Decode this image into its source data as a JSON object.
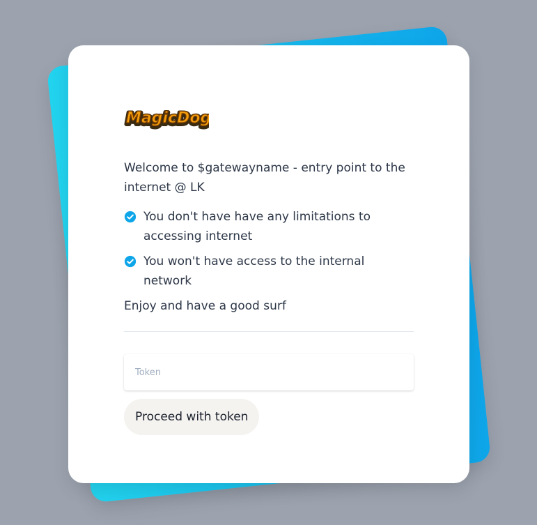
{
  "brand": {
    "logo_text": "MagicDog"
  },
  "content": {
    "welcome": "Welcome to $gatewayname - entry point to the internet @ LK",
    "features": [
      "You don't have have any limitations to accessing internet",
      "You won't have access to the internal network"
    ],
    "closing": "Enjoy and have a good surf"
  },
  "form": {
    "token_placeholder": "Token",
    "token_value": "",
    "proceed_label": "Proceed with token"
  },
  "colors": {
    "page_background": "#9ca3af",
    "accent_gradient_start": "#22d3ee",
    "accent_gradient_end": "#0ea5e9",
    "check_icon": "#0ea5e9"
  }
}
